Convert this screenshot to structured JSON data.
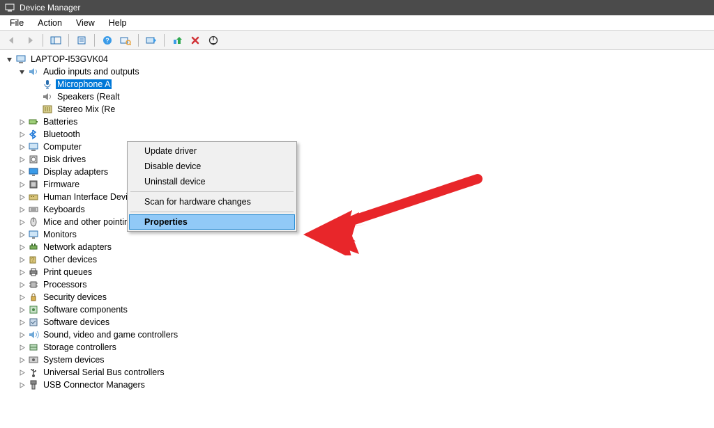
{
  "title": "Device Manager",
  "menu": {
    "file": "File",
    "action": "Action",
    "view": "View",
    "help": "Help"
  },
  "root": {
    "label": "LAPTOP-I53GVK04",
    "expanded": true
  },
  "audio": {
    "label": "Audio inputs and outputs",
    "expanded": true,
    "children": [
      {
        "label": "Microphone A",
        "selected": true
      },
      {
        "label": "Speakers (Realt"
      },
      {
        "label": "Stereo Mix (Re"
      }
    ]
  },
  "categories": [
    {
      "label": "Batteries",
      "icon": "battery"
    },
    {
      "label": "Bluetooth",
      "icon": "bluetooth"
    },
    {
      "label": "Computer",
      "icon": "computer"
    },
    {
      "label": "Disk drives",
      "icon": "disk"
    },
    {
      "label": "Display adapters",
      "icon": "display"
    },
    {
      "label": "Firmware",
      "icon": "firmware"
    },
    {
      "label": "Human Interface Devices",
      "icon": "hid"
    },
    {
      "label": "Keyboards",
      "icon": "keyboard"
    },
    {
      "label": "Mice and other pointing devices",
      "icon": "mouse"
    },
    {
      "label": "Monitors",
      "icon": "monitor"
    },
    {
      "label": "Network adapters",
      "icon": "network"
    },
    {
      "label": "Other devices",
      "icon": "other"
    },
    {
      "label": "Print queues",
      "icon": "printer"
    },
    {
      "label": "Processors",
      "icon": "cpu"
    },
    {
      "label": "Security devices",
      "icon": "security"
    },
    {
      "label": "Software components",
      "icon": "softcomp"
    },
    {
      "label": "Software devices",
      "icon": "softdev"
    },
    {
      "label": "Sound, video and game controllers",
      "icon": "sound"
    },
    {
      "label": "Storage controllers",
      "icon": "storage"
    },
    {
      "label": "System devices",
      "icon": "system"
    },
    {
      "label": "Universal Serial Bus controllers",
      "icon": "usb"
    },
    {
      "label": "USB Connector Managers",
      "icon": "usbconn"
    }
  ],
  "context": {
    "update": "Update driver",
    "disable": "Disable device",
    "uninstall": "Uninstall device",
    "scan": "Scan for hardware changes",
    "properties": "Properties"
  }
}
